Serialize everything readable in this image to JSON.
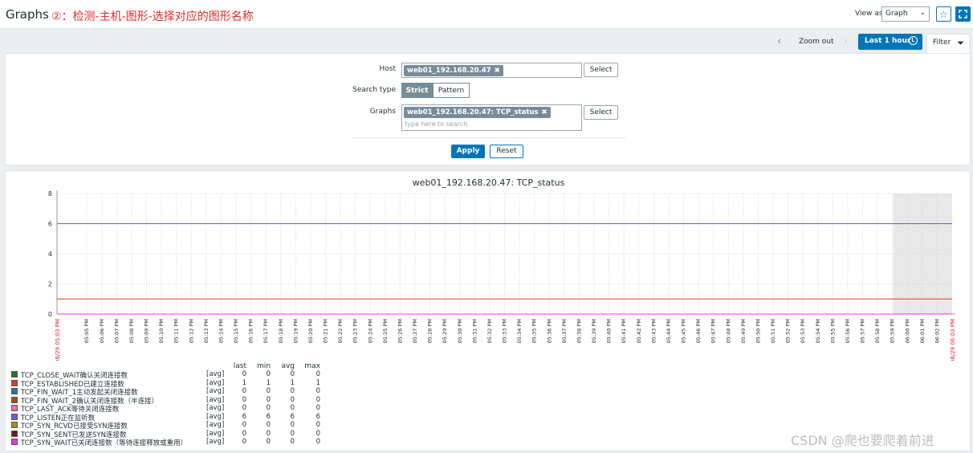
{
  "header": {
    "title": "Graphs",
    "annotation": "②：检测-主机-图形-选择对应的图形名称",
    "view_as_label": "View as",
    "view_as_value": "Graph"
  },
  "timebar": {
    "zoom_out": "Zoom out",
    "period": "Last 1 hour",
    "filter_tab": "Filter"
  },
  "filter": {
    "host_label": "Host",
    "host_tag": "web01_192.168.20.47",
    "select_label": "Select",
    "search_type_label": "Search type",
    "strict": "Strict",
    "pattern": "Pattern",
    "graphs_label": "Graphs",
    "graph_tag": "web01_192.168.20.47: TCP_status",
    "graphs_placeholder": "type here to search",
    "apply": "Apply",
    "reset": "Reset"
  },
  "legend_headers": {
    "last": "last",
    "min": "min",
    "avg": "avg",
    "max": "max"
  },
  "chart_data": {
    "type": "line",
    "title": "web01_192.168.20.47: TCP_status",
    "ylim": [
      0,
      8
    ],
    "yticks": [
      "0",
      "2",
      "4",
      "6",
      "8"
    ],
    "x_start_label": "08/29 05:03 PM",
    "x_end_label": "08/29 06:03 PM",
    "x_ticks": [
      "05:05 PM",
      "05:06 PM",
      "05:07 PM",
      "05:08 PM",
      "05:09 PM",
      "05:10 PM",
      "05:11 PM",
      "05:12 PM",
      "05:13 PM",
      "05:14 PM",
      "05:15 PM",
      "05:16 PM",
      "05:17 PM",
      "05:18 PM",
      "05:19 PM",
      "05:20 PM",
      "05:21 PM",
      "05:22 PM",
      "05:23 PM",
      "05:24 PM",
      "05:25 PM",
      "05:26 PM",
      "05:27 PM",
      "05:28 PM",
      "05:29 PM",
      "05:30 PM",
      "05:31 PM",
      "05:32 PM",
      "05:33 PM",
      "05:34 PM",
      "05:35 PM",
      "05:36 PM",
      "05:37 PM",
      "05:38 PM",
      "05:39 PM",
      "05:40 PM",
      "05:41 PM",
      "05:42 PM",
      "05:43 PM",
      "05:44 PM",
      "05:45 PM",
      "05:46 PM",
      "05:47 PM",
      "05:48 PM",
      "05:49 PM",
      "05:50 PM",
      "05:51 PM",
      "05:52 PM",
      "05:53 PM",
      "05:54 PM",
      "05:55 PM",
      "05:56 PM",
      "05:57 PM",
      "05:58 PM",
      "05:59 PM",
      "06:00 PM",
      "06:01 PM",
      "06:02 PM"
    ],
    "series": [
      {
        "name": "TCP_CLOSE_WAIT确认关闭连接数",
        "color": "#1a7c11",
        "func": "[avg]",
        "last": "0",
        "min": "0",
        "avg": "0",
        "max": "0",
        "value": 0
      },
      {
        "name": "TCP_ESTABLISHED已建立连接数",
        "color": "#e8382a",
        "func": "[avg]",
        "last": "1",
        "min": "1",
        "avg": "1",
        "max": "1",
        "value": 1
      },
      {
        "name": "TCP_FIN_WAIT_1主动发起关闭连接数",
        "color": "#2774a4",
        "func": "[avg]",
        "last": "0",
        "min": "0",
        "avg": "0",
        "max": "0",
        "value": 0
      },
      {
        "name": "TCP_FIN_WAIT_2确认关闭连接数（半连接）",
        "color": "#a54f10",
        "func": "[avg]",
        "last": "0",
        "min": "0",
        "avg": "0",
        "max": "0",
        "value": 0
      },
      {
        "name": "TCP_LAST_ACK等待关闭连接数",
        "color": "#fc6ea3",
        "func": "[avg]",
        "last": "0",
        "min": "0",
        "avg": "0",
        "max": "0",
        "value": 0
      },
      {
        "name": "TCP_LISTEN正在监听数",
        "color": "#6c59dc",
        "func": "[avg]",
        "last": "6",
        "min": "6",
        "avg": "6",
        "max": "6",
        "value": 6
      },
      {
        "name": "TCP_SYN_RCVD已接受SYN连接数",
        "color": "#ac8c14",
        "func": "[avg]",
        "last": "0",
        "min": "0",
        "avg": "0",
        "max": "0",
        "value": 0
      },
      {
        "name": "TCP_SYN_SENT已发送SYN连接数",
        "color": "#611f27",
        "func": "[avg]",
        "last": "0",
        "min": "0",
        "avg": "0",
        "max": "0",
        "value": 0
      },
      {
        "name": "TCP_SYN_WAIT已关闭连接数（等待连接释放或重用）",
        "color": "#f230e0",
        "func": "[avg]",
        "last": "0",
        "min": "0",
        "avg": "0",
        "max": "0",
        "value": 0
      }
    ]
  },
  "watermark": "CSDN @爬也要爬着前进",
  "colors": {
    "accent": "#0275b8",
    "annotation": "#e02b2b",
    "time_label": "#e02b2b"
  }
}
